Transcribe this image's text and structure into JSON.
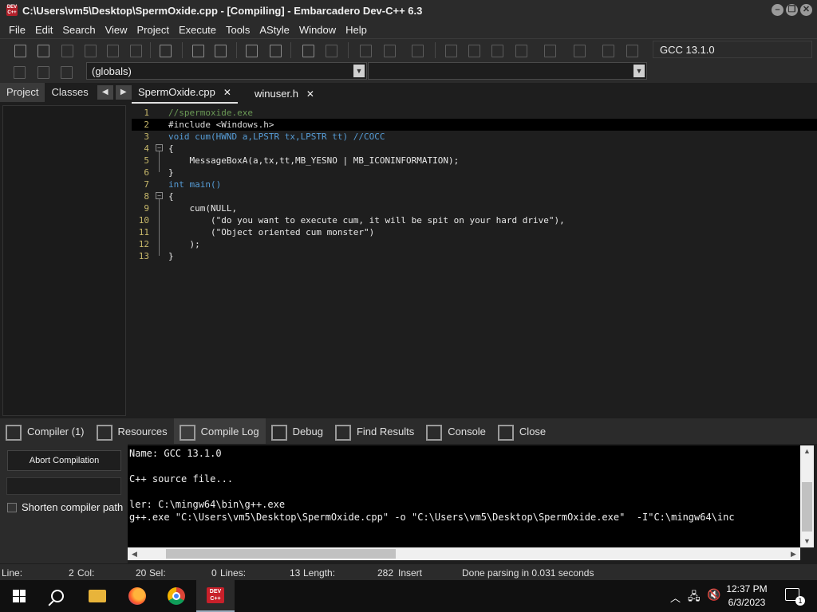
{
  "window": {
    "title": "C:\\Users\\vm5\\Desktop\\SpermOxide.cpp - [Compiling] - Embarcadero Dev-C++ 6.3",
    "app_icon_text": "DEV C++"
  },
  "menu": [
    "File",
    "Edit",
    "Search",
    "View",
    "Project",
    "Execute",
    "Tools",
    "AStyle",
    "Window",
    "Help"
  ],
  "toolbar": {
    "compiler": "GCC 13.1.0",
    "scope_combo": "(globals)",
    "member_combo": ""
  },
  "left_panel": {
    "tabs": [
      "Project",
      "Classes"
    ],
    "active_tab": "Project"
  },
  "editor": {
    "tabs": [
      {
        "label": "SpermOxide.cpp",
        "active": true
      },
      {
        "label": "winuser.h",
        "active": false
      }
    ],
    "lines": [
      {
        "n": "1",
        "text": "//spermoxide.exe"
      },
      {
        "n": "2",
        "text": "#include <Windows.h>"
      },
      {
        "n": "3",
        "text": "void cum(HWND a,LPSTR tx,LPSTR tt) //COCC"
      },
      {
        "n": "4",
        "text": "{"
      },
      {
        "n": "5",
        "text": "    MessageBoxA(a,tx,tt,MB_YESNO | MB_ICONINFORMATION);"
      },
      {
        "n": "6",
        "text": "}"
      },
      {
        "n": "7",
        "text": "int main()"
      },
      {
        "n": "8",
        "text": "{"
      },
      {
        "n": "9",
        "text": "    cum(NULL,"
      },
      {
        "n": "10",
        "text": "        (\"do you want to execute cum, it will be spit on your hard drive\"),"
      },
      {
        "n": "11",
        "text": "        (\"Object oriented cum monster\")"
      },
      {
        "n": "12",
        "text": "    );"
      },
      {
        "n": "13",
        "text": "}"
      }
    ]
  },
  "bottom_tabs": [
    {
      "label": "Compiler (1)",
      "icon": "grid-icon"
    },
    {
      "label": "Resources",
      "icon": "resources-icon"
    },
    {
      "label": "Compile Log",
      "icon": "chart-icon",
      "active": true
    },
    {
      "label": "Debug",
      "icon": "check-icon"
    },
    {
      "label": "Find Results",
      "icon": "find-icon"
    },
    {
      "label": "Console",
      "icon": "console-icon"
    },
    {
      "label": "Close",
      "icon": "close-icon"
    }
  ],
  "compile_controls": {
    "abort_label": "Abort Compilation",
    "shorten_label": "Shorten compiler path"
  },
  "compile_log": [
    "Name: GCC 13.1.0",
    "",
    "C++ source file...",
    "",
    "ler: C:\\mingw64\\bin\\g++.exe",
    "g++.exe \"C:\\Users\\vm5\\Desktop\\SpermOxide.cpp\" -o \"C:\\Users\\vm5\\Desktop\\SpermOxide.exe\"  -I\"C:\\mingw64\\inc"
  ],
  "status": {
    "line_label": "Line:",
    "line_value": "2",
    "col_label": "Col:",
    "col_value": "20",
    "sel_label": "Sel:",
    "sel_value": "0",
    "lines_label": "Lines:",
    "lines_value": "13",
    "length_label": "Length:",
    "length_value": "282",
    "mode": "Insert",
    "message": "Done parsing in 0.031 seconds"
  },
  "taskbar": {
    "time": "12:37 PM",
    "date": "6/3/2023",
    "notification_count": "1"
  }
}
